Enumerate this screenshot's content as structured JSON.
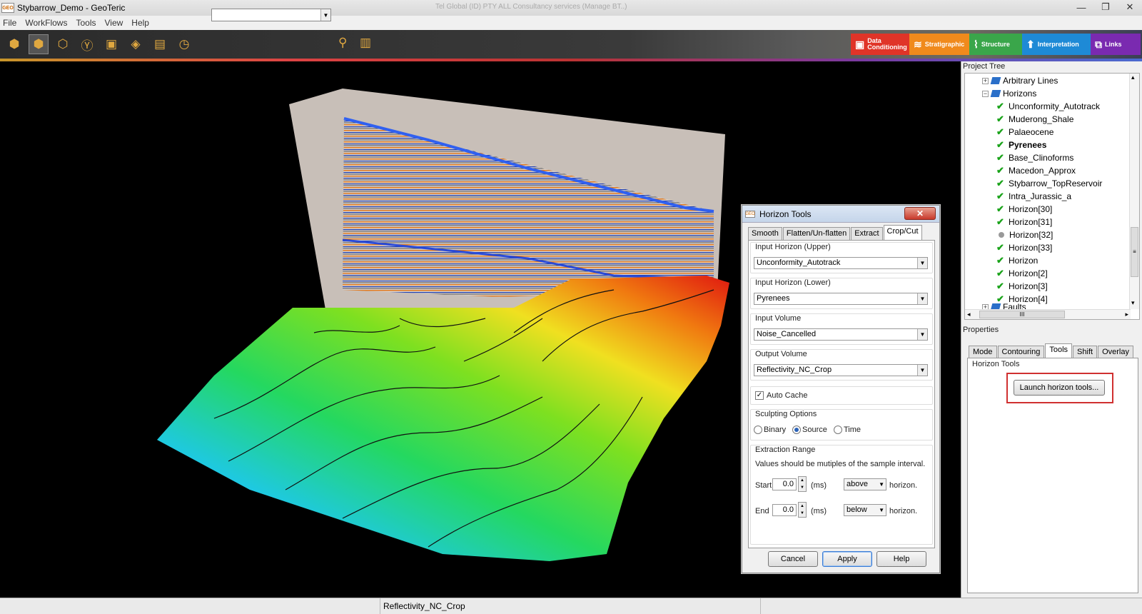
{
  "window": {
    "title": "Stybarrow_Demo - GeoTeric",
    "faded_title": "Tel Global (ID) PTY ALL Consultancy services (Manage BT..)",
    "app_icon_label": "GEO",
    "minimize_glyph": "—",
    "maximize_glyph": "❐",
    "close_glyph": "✕"
  },
  "menu": [
    "File",
    "WorkFlows",
    "Tools",
    "View",
    "Help"
  ],
  "toolbar": {
    "icons": [
      "cube-icon",
      "cube-select-icon",
      "cube-axes-icon",
      "cube-y-icon",
      "cube-slice-icon",
      "cube-rotate-icon",
      "layers-icon",
      "stopwatch-icon"
    ],
    "glyphs": [
      "⬢",
      "⬢",
      "⬡",
      "Ⓨ",
      "▣",
      "◈",
      "▤",
      "◷"
    ],
    "combo_value": "",
    "pin_glyph": "⚲",
    "clipboard_glyph": "▥",
    "dropdown_glyph": "▼"
  },
  "modules": [
    {
      "label": "Data Conditioning",
      "color": "#e03428",
      "icon": "▣"
    },
    {
      "label": "Stratigraphic",
      "color": "#f08a1c",
      "icon": "≋"
    },
    {
      "label": "Structure",
      "color": "#3aa64a",
      "icon": "⌇"
    },
    {
      "label": "Interpretation",
      "color": "#1e8ad6",
      "icon": "⬆"
    },
    {
      "label": "Links",
      "color": "#7a2ab0",
      "icon": "⧉"
    }
  ],
  "dialog": {
    "title": "Horizon Tools",
    "icon_label": "GEO",
    "close_glyph": "✕",
    "tabs": [
      "Smooth",
      "Flatten/Un-flatten",
      "Extract",
      "Crop/Cut"
    ],
    "active_tab": "Crop/Cut",
    "input_upper_label": "Input Horizon (Upper)",
    "input_upper_value": "Unconformity_Autotrack",
    "input_lower_label": "Input Horizon (Lower)",
    "input_lower_value": "Pyrenees",
    "input_volume_label": "Input Volume",
    "input_volume_value": "Noise_Cancelled",
    "output_volume_label": "Output Volume",
    "output_volume_value": "Reflectivity_NC_Crop",
    "auto_cache_label": "Auto Cache",
    "auto_cache_checked": true,
    "check_glyph": "✓",
    "sculpting_label": "Sculpting Options",
    "sculpt_options": [
      "Binary",
      "Source",
      "Time"
    ],
    "sculpt_selected": "Source",
    "extraction_label": "Extraction Range",
    "extraction_note": "Values should be mutiples of the sample interval.",
    "start_label": "Start",
    "start_value": "0.0",
    "start_position": "above",
    "end_label": "End",
    "end_value": "0.0",
    "end_position": "below",
    "ms_label": "(ms)",
    "horizon_suffix": "horizon.",
    "spin_up": "▲",
    "spin_down": "▼",
    "buttons": {
      "cancel": "Cancel",
      "apply": "Apply",
      "help": "Help"
    }
  },
  "project_tree": {
    "header": "Project Tree",
    "expand_glyph": "+",
    "collapse_glyph": "−",
    "check_glyph": "✔",
    "arbitrary_lines": "Arbitrary Lines",
    "horizons_label": "Horizons",
    "items": [
      {
        "name": "Unconformity_Autotrack",
        "state": "checked"
      },
      {
        "name": "Muderong_Shale",
        "state": "checked"
      },
      {
        "name": "Palaeocene",
        "state": "checked"
      },
      {
        "name": "Pyrenees",
        "state": "checked",
        "bold": true
      },
      {
        "name": "Base_Clinoforms",
        "state": "checked"
      },
      {
        "name": "Macedon_Approx",
        "state": "checked"
      },
      {
        "name": "Stybarrow_TopReservoir",
        "state": "checked"
      },
      {
        "name": "Intra_Jurassic_a",
        "state": "checked"
      },
      {
        "name": "Horizon[30]",
        "state": "checked"
      },
      {
        "name": "Horizon[31]",
        "state": "checked"
      },
      {
        "name": "Horizon[32]",
        "state": "dot"
      },
      {
        "name": "Horizon[33]",
        "state": "checked"
      },
      {
        "name": "Horizon",
        "state": "checked"
      },
      {
        "name": "Horizon[2]",
        "state": "checked"
      },
      {
        "name": "Horizon[3]",
        "state": "checked"
      },
      {
        "name": "Horizon[4]",
        "state": "checked"
      }
    ],
    "partial_next": "Faults",
    "scroll_grip": "III",
    "scroll_left": "◂",
    "scroll_right": "▸",
    "scroll_up": "▴",
    "scroll_down": "▾",
    "vscroll_grip": "≡"
  },
  "properties": {
    "header": "Properties",
    "tabs": [
      "Mode",
      "Contouring",
      "Tools",
      "Shift",
      "Overlay"
    ],
    "active_tab": "Tools",
    "group_label": "Horizon Tools",
    "launch_button": "Launch horizon tools..."
  },
  "status": {
    "text": "Reflectivity_NC_Crop"
  }
}
